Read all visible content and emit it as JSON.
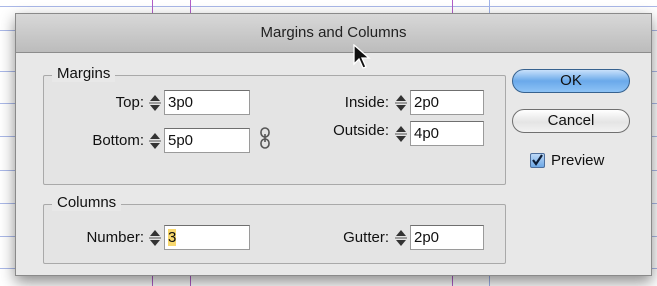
{
  "dialog": {
    "title": "Margins and Columns",
    "margins": {
      "legend": "Margins",
      "top_label": "Top:",
      "top_value": "3p0",
      "bottom_label": "Bottom:",
      "bottom_value": "5p0",
      "inside_label": "Inside:",
      "inside_value": "2p0",
      "outside_label": "Outside:",
      "outside_value": "4p0"
    },
    "columns": {
      "legend": "Columns",
      "number_label": "Number:",
      "number_value": "3",
      "gutter_label": "Gutter:",
      "gutter_value": "2p0"
    },
    "buttons": {
      "ok": "OK",
      "cancel": "Cancel"
    },
    "preview": {
      "label": "Preview",
      "checked": true
    }
  },
  "colors": {
    "default_button": "#6aa9ea",
    "guide_horizontal": "#aab8e8",
    "guide_vertical": "#b05ec8",
    "selection_highlight": "#f8d86e"
  },
  "icons": [
    "stepper-arrows-icon",
    "chain-link-icon",
    "arrow-cursor-icon",
    "checkmark-icon"
  ]
}
